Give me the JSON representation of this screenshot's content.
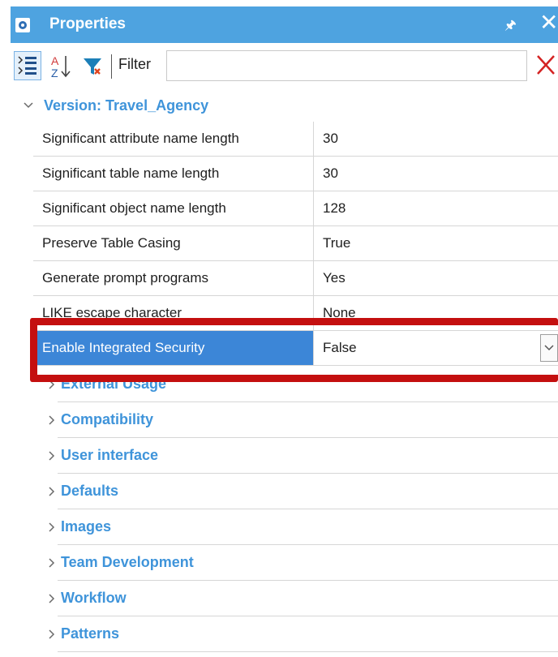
{
  "window": {
    "title": "Properties",
    "pin_glyph": "↕",
    "close_glyph": "✕"
  },
  "toolbar": {
    "filter_label": "Filter",
    "filter_value": ""
  },
  "group": {
    "title": "Version: Travel_Agency"
  },
  "properties": [
    {
      "name": "Significant attribute name length",
      "value": "30"
    },
    {
      "name": "Significant table name length",
      "value": "30"
    },
    {
      "name": "Significant object name length",
      "value": "128"
    },
    {
      "name": "Preserve Table Casing",
      "value": "True"
    },
    {
      "name": "Generate prompt programs",
      "value": "Yes"
    },
    {
      "name": "LIKE escape character",
      "value": "None"
    },
    {
      "name": "Enable Integrated Security",
      "value": "False"
    }
  ],
  "subgroups": [
    {
      "title": "External Usage"
    },
    {
      "title": "Compatibility"
    },
    {
      "title": "User interface"
    },
    {
      "title": "Defaults"
    },
    {
      "title": "Images"
    },
    {
      "title": "Team Development"
    },
    {
      "title": "Workflow"
    },
    {
      "title": "Patterns"
    }
  ],
  "colors": {
    "accent": "#3f94da",
    "titlebar": "#4ea3e0",
    "selection": "#3c86d7",
    "highlight": "#c40f0f"
  },
  "icons": [
    "gear-icon",
    "categorized-icon",
    "sort-alpha-icon",
    "filter-icon",
    "clear-filter-icon",
    "chevron-down-icon",
    "chevron-right-icon",
    "dropdown-arrow-icon"
  ]
}
